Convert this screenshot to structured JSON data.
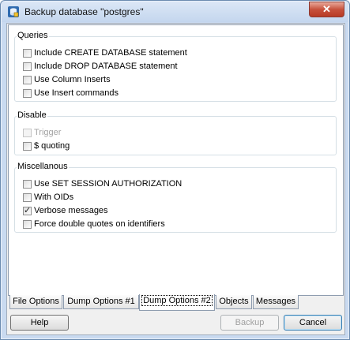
{
  "window": {
    "title": "Backup database \"postgres\"",
    "close_label": "✕"
  },
  "groups": {
    "queries": {
      "label": "Queries",
      "items": [
        {
          "label": "Include CREATE DATABASE statement",
          "checked": false,
          "enabled": true
        },
        {
          "label": "Include DROP DATABASE statement",
          "checked": false,
          "enabled": true
        },
        {
          "label": "Use Column Inserts",
          "checked": false,
          "enabled": true
        },
        {
          "label": "Use Insert commands",
          "checked": false,
          "enabled": true
        }
      ]
    },
    "disable": {
      "label": "Disable",
      "items": [
        {
          "label": "Trigger",
          "checked": false,
          "enabled": false
        },
        {
          "label": "$ quoting",
          "checked": false,
          "enabled": true
        }
      ]
    },
    "misc": {
      "label": "Miscellanous",
      "items": [
        {
          "label": "Use SET SESSION AUTHORIZATION",
          "checked": false,
          "enabled": true
        },
        {
          "label": "With OIDs",
          "checked": false,
          "enabled": true
        },
        {
          "label": "Verbose messages",
          "checked": true,
          "enabled": true
        },
        {
          "label": "Force double quotes on identifiers",
          "checked": false,
          "enabled": true
        }
      ]
    }
  },
  "tabs": [
    {
      "label": "File Options",
      "active": false
    },
    {
      "label": "Dump Options #1",
      "active": false
    },
    {
      "label": "Dump Options #2",
      "active": true
    },
    {
      "label": "Objects",
      "active": false
    },
    {
      "label": "Messages",
      "active": false
    }
  ],
  "buttons": {
    "help": "Help",
    "backup": "Backup",
    "cancel": "Cancel"
  },
  "colors": {
    "window_frame": "#c9daf0",
    "close_button": "#c7513c",
    "dialog_bg": "#f0f0f0"
  }
}
